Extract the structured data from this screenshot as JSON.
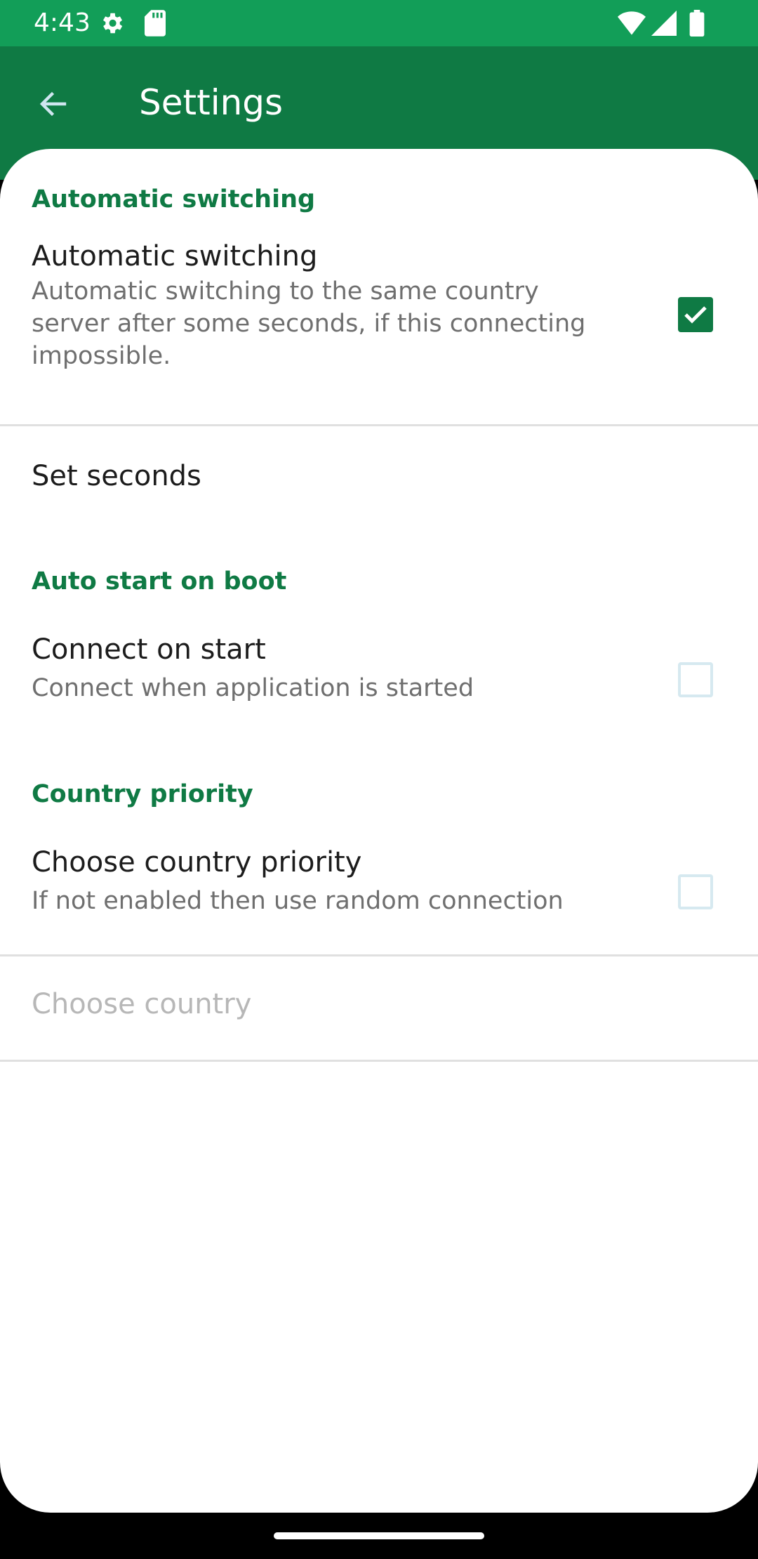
{
  "status_bar": {
    "time": "4:43",
    "icons": [
      "settings-gear-icon",
      "sd-card-icon",
      "wifi-icon",
      "cellular-signal-icon",
      "battery-icon"
    ]
  },
  "app_bar": {
    "title": "Settings",
    "back_icon": "arrow-back-icon"
  },
  "sections": {
    "automatic_switching": {
      "header": "Automatic switching",
      "pref_title": "Automatic switching",
      "pref_summary": "Automatic switching to the same country server after some seconds, if this connecting impossible.",
      "checked": true
    },
    "set_seconds": {
      "title": "Set seconds"
    },
    "auto_start": {
      "header": "Auto start on boot",
      "pref_title": "Connect on start",
      "pref_summary": "Connect when application is started",
      "checked": false
    },
    "country_priority": {
      "header": "Country priority",
      "pref_title": "Choose country priority",
      "pref_summary": "If not enabled then use random connection",
      "checked": false
    },
    "choose_country": {
      "title": "Choose country",
      "enabled": false
    }
  },
  "colors": {
    "status_bar": "#129e58",
    "app_bar": "#0f7a44",
    "accent": "#0f7a44",
    "checkbox_unchecked_border": "#d6e9f0"
  }
}
